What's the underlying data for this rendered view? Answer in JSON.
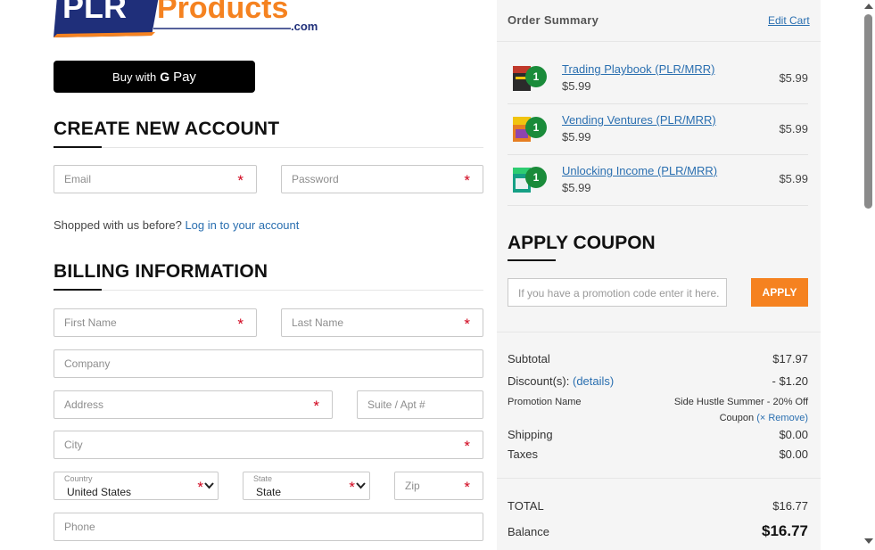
{
  "logo": {
    "brand_left": "PLR",
    "brand_right": "Products",
    "tld": ".com"
  },
  "gpay": {
    "prefix": "Buy with",
    "g": "G",
    "pay": "Pay"
  },
  "account": {
    "title": "CREATE NEW ACCOUNT",
    "email_placeholder": "Email",
    "password_placeholder": "Password",
    "required_mark": "*"
  },
  "login_prompt": {
    "text": "Shopped with us before?",
    "link": "Log in to your account"
  },
  "billing": {
    "title": "BILLING INFORMATION",
    "first_name": "First Name",
    "last_name": "Last Name",
    "company": "Company",
    "address": "Address",
    "suite": "Suite / Apt #",
    "city": "City",
    "country_label": "Country",
    "country_value": "United States",
    "state_label": "State",
    "state_value": "State",
    "zip": "Zip",
    "phone": "Phone"
  },
  "order_summary": {
    "title": "Order Summary",
    "edit_cart": "Edit Cart",
    "items": [
      {
        "name": "Trading Playbook (PLR/MRR)",
        "qty": "1",
        "unit_price": "$5.99",
        "price": "$5.99"
      },
      {
        "name": "Vending Ventures (PLR/MRR)",
        "qty": "1",
        "unit_price": "$5.99",
        "price": "$5.99"
      },
      {
        "name": "Unlocking Income (PLR/MRR)",
        "qty": "1",
        "unit_price": "$5.99",
        "price": "$5.99"
      }
    ]
  },
  "coupon": {
    "title": "APPLY COUPON",
    "placeholder": "If you have a promotion code enter it here.",
    "button": "APPLY"
  },
  "totals": {
    "subtotal_label": "Subtotal",
    "subtotal": "$17.97",
    "discount_label": "Discount(s):",
    "discount_link": "(details)",
    "discount": "- $1.20",
    "promo_label": "Promotion Name",
    "promo_name": "Side Hustle Summer - 20% Off",
    "promo_type": "Coupon",
    "promo_remove": "(× Remove)",
    "shipping_label": "Shipping",
    "shipping": "$0.00",
    "taxes_label": "Taxes",
    "taxes": "$0.00",
    "total_label": "TOTAL",
    "total": "$16.77",
    "balance_label": "Balance",
    "balance": "$16.77"
  },
  "colors": {
    "accent_orange": "#f58220",
    "link_blue": "#2a6fb0",
    "badge_green": "#1a8b3a",
    "required_red": "#d0021b",
    "logo_blue": "#1f2f7a"
  }
}
